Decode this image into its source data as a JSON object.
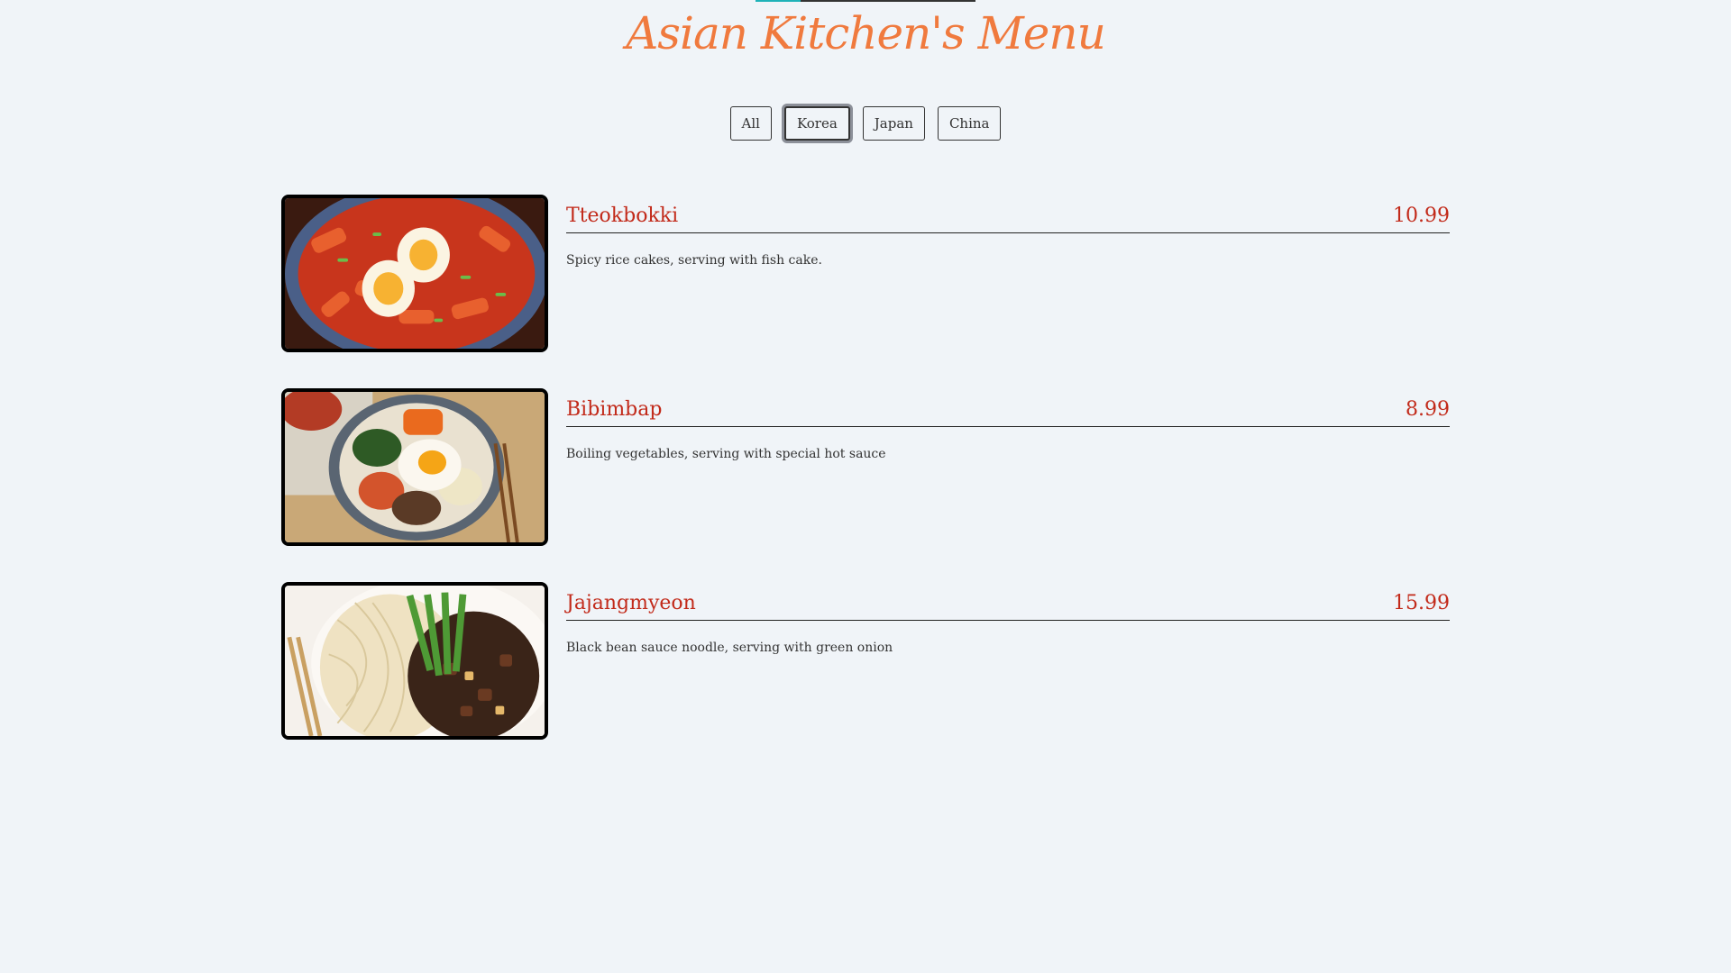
{
  "header": {
    "title": "Asian Kitchen's Menu"
  },
  "filters": [
    {
      "label": "All",
      "active": false
    },
    {
      "label": "Korea",
      "active": true
    },
    {
      "label": "Japan",
      "active": false
    },
    {
      "label": "China",
      "active": false
    }
  ],
  "menu": {
    "items": [
      {
        "name": "Tteokbokki",
        "price": "10.99",
        "description": "Spicy rice cakes, serving with fish cake.",
        "image": "tteokbokki-photo"
      },
      {
        "name": "Bibimbap",
        "price": "8.99",
        "description": "Boiling vegetables, serving with special hot sauce",
        "image": "bibimbap-photo"
      },
      {
        "name": "Jajangmyeon",
        "price": "15.99",
        "description": "Black bean sauce noodle, serving with green onion",
        "image": "jajangmyeon-photo"
      }
    ]
  },
  "colors": {
    "background": "#f0f4f8",
    "title": "#f07a3e",
    "item_text": "#c22a1a",
    "accent": "#1fb2b8"
  }
}
